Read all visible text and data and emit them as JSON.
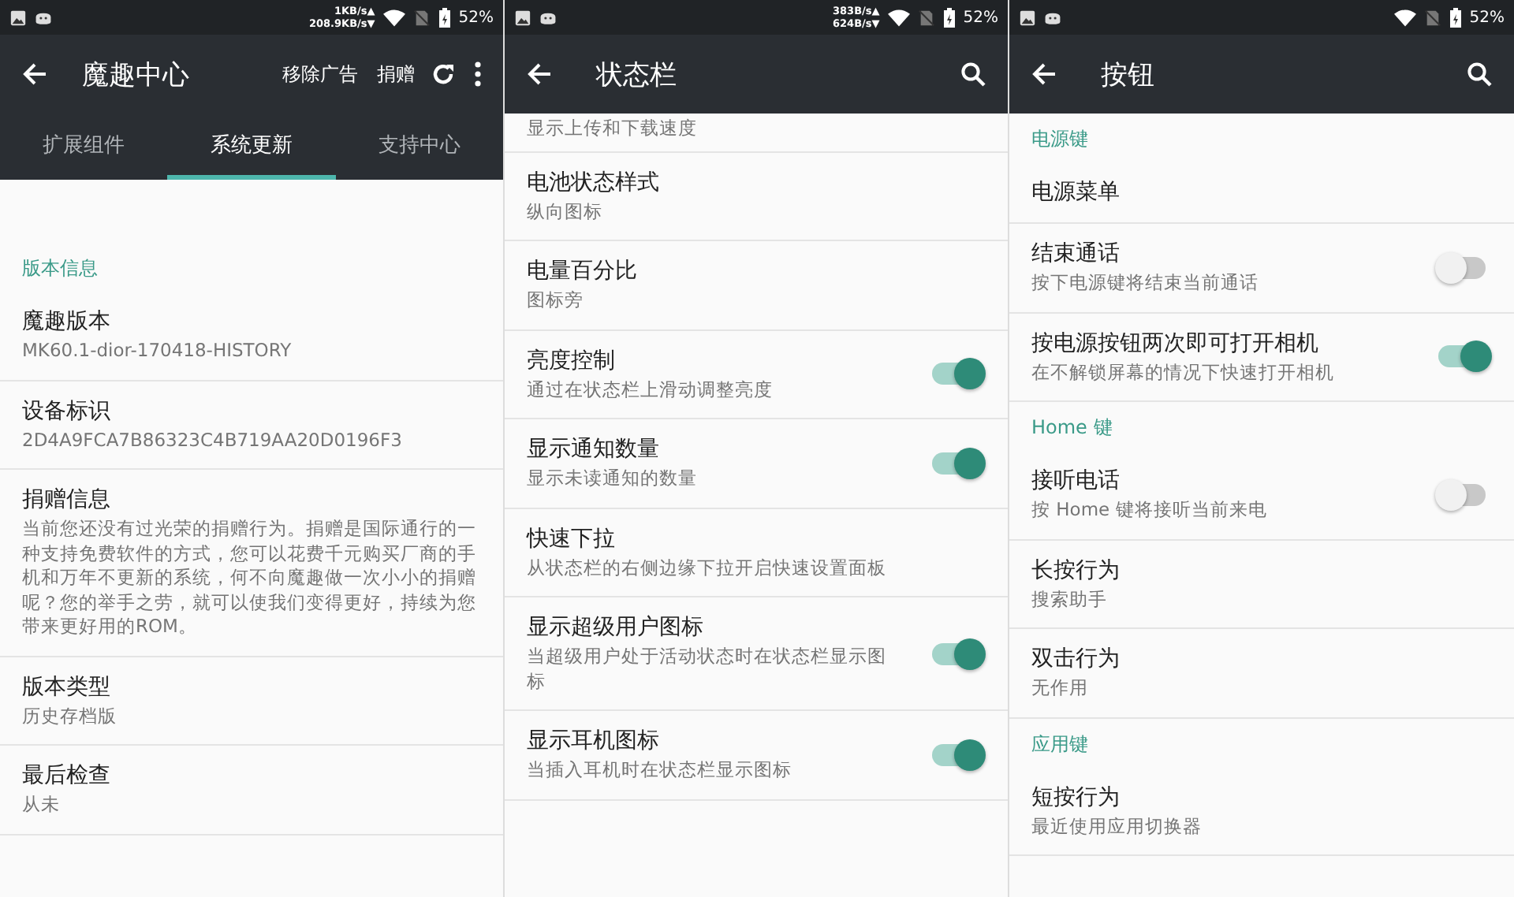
{
  "panels": [
    {
      "kind": "main",
      "status_bar": {
        "speed_up": "1KB/s▲",
        "speed_down": "208.9KB/s▼",
        "battery": "52%"
      },
      "toolbar": {
        "title": "魔趣中心",
        "actions": [
          "移除广告",
          "捐赠"
        ]
      },
      "tabs": [
        {
          "label": "扩展组件",
          "selected": false
        },
        {
          "label": "系统更新",
          "selected": true
        },
        {
          "label": "支持中心",
          "selected": false
        }
      ],
      "items": [
        {
          "kind": "category",
          "title": "版本信息"
        },
        {
          "kind": "row",
          "title": "魔趣版本",
          "summary": "MK60.1-dior-170418-HISTORY"
        },
        {
          "kind": "row",
          "title": "设备标识",
          "summary": "2D4A9FCA7B86323C4B719AA20D0196F3"
        },
        {
          "kind": "row",
          "title": "捐赠信息",
          "summary": "当前您还没有过光荣的捐赠行为。捐赠是国际通行的一种支持免费软件的方式，您可以花费千元购买厂商的手机和万年不更新的系统，何不向魔趣做一次小小的捐赠呢？您的举手之劳，就可以使我们变得更好，持续为您带来更好用的ROM。"
        },
        {
          "kind": "row",
          "title": "版本类型",
          "summary": "历史存档版"
        },
        {
          "kind": "row",
          "title": "最后检查",
          "summary": "从未"
        }
      ]
    },
    {
      "kind": "settings",
      "status_bar": {
        "speed_up": "383B/s▲",
        "speed_down": "624B/s▼",
        "battery": "52%"
      },
      "toolbar": {
        "title": "状态栏"
      },
      "items": [
        {
          "kind": "partial",
          "summary": "显示上传和下载速度"
        },
        {
          "kind": "row",
          "title": "电池状态样式",
          "summary": "纵向图标"
        },
        {
          "kind": "row",
          "title": "电量百分比",
          "summary": "图标旁"
        },
        {
          "kind": "toggle",
          "title": "亮度控制",
          "summary": "通过在状态栏上滑动调整亮度",
          "on": true
        },
        {
          "kind": "toggle",
          "title": "显示通知数量",
          "summary": "显示未读通知的数量",
          "on": true
        },
        {
          "kind": "row",
          "title": "快速下拉",
          "summary": "从状态栏的右侧边缘下拉开启快速设置面板"
        },
        {
          "kind": "toggle",
          "title": "显示超级用户图标",
          "summary": "当超级用户处于活动状态时在状态栏显示图标",
          "on": true
        },
        {
          "kind": "toggle",
          "title": "显示耳机图标",
          "summary": "当插入耳机时在状态栏显示图标",
          "on": true
        }
      ]
    },
    {
      "kind": "settings",
      "status_bar": {
        "battery": "52%"
      },
      "toolbar": {
        "title": "按钮"
      },
      "items": [
        {
          "kind": "category",
          "title": "电源键"
        },
        {
          "kind": "row",
          "title": "电源菜单"
        },
        {
          "kind": "toggle",
          "title": "结束通话",
          "summary": "按下电源键将结束当前通话",
          "on": false
        },
        {
          "kind": "toggle",
          "title": "按电源按钮两次即可打开相机",
          "summary": "在不解锁屏幕的情况下快速打开相机",
          "on": true
        },
        {
          "kind": "category",
          "title": "Home 键"
        },
        {
          "kind": "toggle",
          "title": "接听电话",
          "summary": "按 Home 键将接听当前来电",
          "on": false
        },
        {
          "kind": "row",
          "title": "长按行为",
          "summary": "搜索助手"
        },
        {
          "kind": "row",
          "title": "双击行为",
          "summary": "无作用"
        },
        {
          "kind": "category",
          "title": "应用键"
        },
        {
          "kind": "row",
          "title": "短按行为",
          "summary": "最近使用应用切换器"
        }
      ]
    }
  ]
}
